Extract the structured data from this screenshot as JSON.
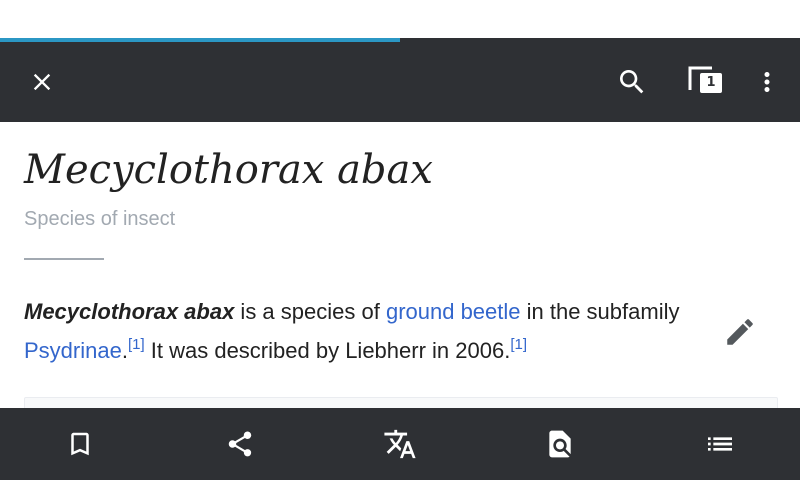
{
  "progress": {
    "loaded_fraction": 0.5,
    "color": "#2b97c4"
  },
  "toolbar": {
    "background": "#2e3034",
    "close_icon": "close-icon",
    "search_icon": "search-icon",
    "tabs_icon": "tabs-icon",
    "tabs_count": "1",
    "overflow_icon": "more-vert-icon"
  },
  "article": {
    "title": "Mecyclothorax abax",
    "description": "Species of insect",
    "paragraph": {
      "bold_name": "Mecyclothorax abax",
      "text_1": " is a species of ",
      "link_1": "ground beetle",
      "text_2": " in the subfamily ",
      "link_2": "Psydrinae",
      "text_3": ".",
      "ref_1": "[1]",
      "text_4": " It was described by Liebherr in 2006.",
      "ref_2": "[1]"
    },
    "edit_icon": "pencil-icon",
    "link_color": "#3366cc"
  },
  "bottom_bar": {
    "items": [
      {
        "icon": "bookmark-icon"
      },
      {
        "icon": "share-icon"
      },
      {
        "icon": "translate-icon"
      },
      {
        "icon": "find-in-page-icon"
      },
      {
        "icon": "table-of-contents-icon"
      }
    ]
  }
}
